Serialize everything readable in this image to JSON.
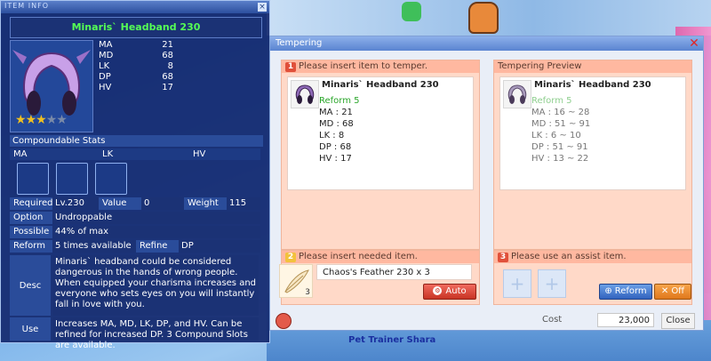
{
  "background": {
    "pet_label": "Pet Trainer Shara"
  },
  "item_info": {
    "window_title": "ITEM INFO",
    "item_name": "Minaris` Headband 230",
    "stats": [
      {
        "label": "MA",
        "value": "21"
      },
      {
        "label": "MD",
        "value": "68"
      },
      {
        "label": "LK",
        "value": "8"
      },
      {
        "label": "DP",
        "value": "68"
      },
      {
        "label": "HV",
        "value": "17"
      }
    ],
    "stars": {
      "filled": 3,
      "total": 5
    },
    "compound_header": "Compoundable Stats",
    "compound_labels": [
      "MA",
      "LK",
      "HV"
    ],
    "required_label": "Required",
    "required_value": "Lv.230",
    "value_label": "Value",
    "value_value": "0",
    "weight_label": "Weight",
    "weight_value": "115",
    "option_label": "Option",
    "option_value": "Undroppable",
    "possible_label": "Possible",
    "possible_value": "44% of max",
    "reform_label": "Reform",
    "reform_value": "5 times available",
    "refine_label": "Refine",
    "refine_value": "DP",
    "desc_label": "Desc",
    "desc_text": "Minaris` headband could be considered dangerous in the hands of wrong people. When equipped your charisma increases and everyone who sets eyes on you will instantly fall in love with you.",
    "use_label": "Use",
    "use_text": "Increases MA, MD, LK, DP, and HV. Can be refined for increased DP. 3 Compound Slots are available."
  },
  "tempering": {
    "title": "Tempering",
    "step1": {
      "num": "1",
      "text": "Please insert item to temper."
    },
    "preview_header": "Tempering Preview",
    "item_card": {
      "name": "Minaris` Headband 230",
      "reform": "Reform 5",
      "lines": [
        "MA : 21",
        "MD : 68",
        "LK : 8",
        "DP : 68",
        "HV : 17"
      ]
    },
    "preview_card": {
      "name": "Minaris` Headband 230",
      "reform": "Reform 5",
      "lines": [
        "MA : 16 ~ 28",
        "MD : 51 ~ 91",
        "LK : 6 ~ 10",
        "DP : 51 ~ 91",
        "HV : 13 ~ 22"
      ]
    },
    "step2": {
      "num": "2",
      "text": "Please insert needed item."
    },
    "needed_item": {
      "name": "Chaos's Feather 230 x 3",
      "icon_count": "3"
    },
    "auto_button": "Auto",
    "step3": {
      "num": "3",
      "text": "Please use an assist item."
    },
    "reform_button": "Reform",
    "off_button": "Off",
    "cost_label": "Cost",
    "cost_value": "23,000",
    "close_button": "Close"
  },
  "colors": {
    "item_name": "#55ff55",
    "reform_green": "#2aa62a",
    "info_bg": "#14286e",
    "panel_bg": "#ffd9c8"
  }
}
